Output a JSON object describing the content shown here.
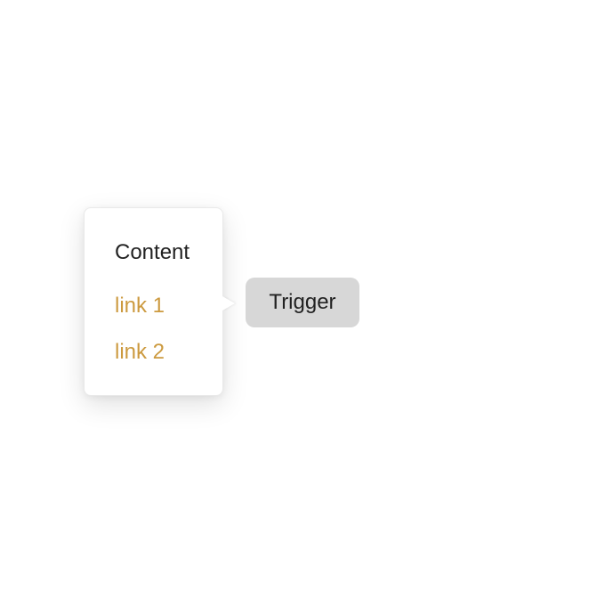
{
  "popover": {
    "title": "Content",
    "links": [
      {
        "label": "link 1"
      },
      {
        "label": "link 2"
      }
    ]
  },
  "trigger": {
    "label": "Trigger"
  },
  "colors": {
    "link": "#cc9a3f",
    "text": "#222222",
    "trigger_background": "#d7d7d7",
    "popover_background": "#ffffff"
  }
}
